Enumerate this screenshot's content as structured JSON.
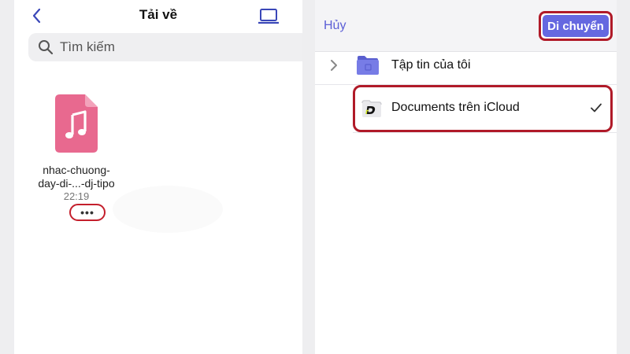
{
  "left_panel": {
    "title": "Tải về",
    "search": {
      "placeholder": "Tìm kiếm"
    },
    "file": {
      "name_line1": "nhac-chuong-",
      "name_line2": "day-di-...-dj-tipo",
      "time": "22:19",
      "more_label": "•••"
    },
    "icons": {
      "back": "chevron-left-icon",
      "device": "laptop-icon",
      "search": "search-icon",
      "file": "music-file-icon"
    },
    "colors": {
      "accent": "#3a47b8",
      "file_icon": "#e8698f",
      "highlight_border": "#c41f2c"
    }
  },
  "right_panel": {
    "cancel_label": "Hủy",
    "move_label": "Di chuyển",
    "rows": [
      {
        "label": "Tập tin của tôi",
        "icon": "folder-icon",
        "expandable": true,
        "selected": false
      },
      {
        "label": "Documents trên iCloud",
        "icon": "documents-app-folder-icon",
        "expandable": false,
        "selected": true
      }
    ],
    "colors": {
      "accent": "#6568e0",
      "highlight_border": "#b01a28"
    }
  }
}
